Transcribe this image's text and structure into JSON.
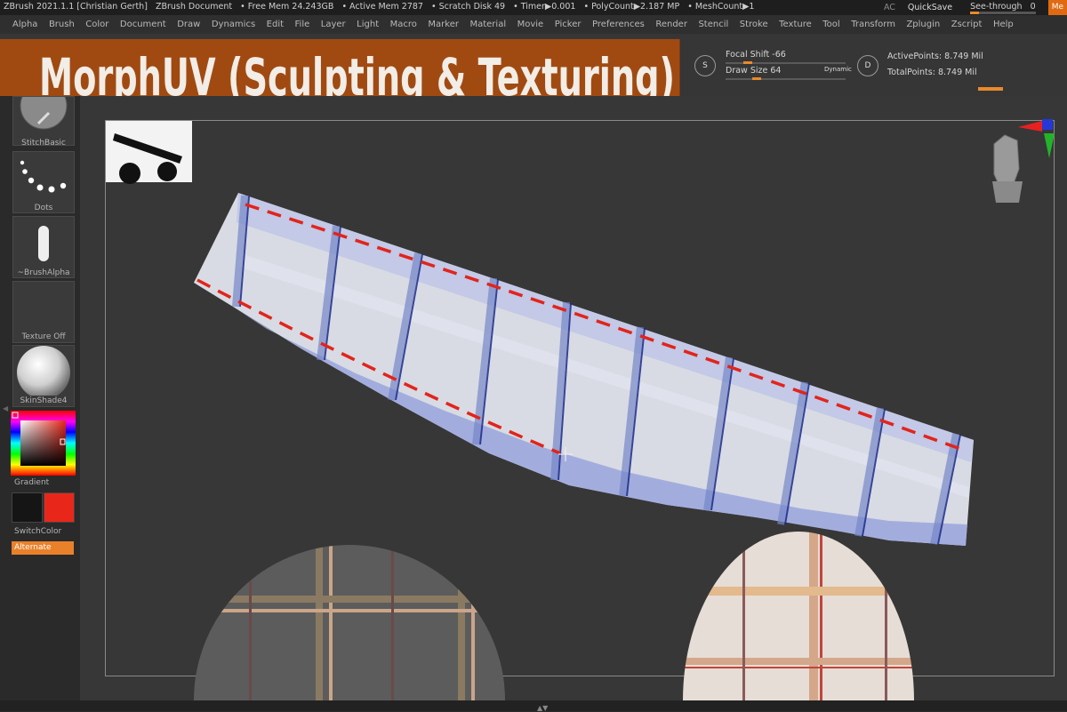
{
  "titlebar": {
    "app_title": "ZBrush 2021.1.1 [Christian Gerth]",
    "document": "ZBrush Document",
    "free_mem": "• Free Mem 24.243GB",
    "active_mem": "• Active Mem 2787",
    "scratch_disk": "• Scratch Disk 49",
    "timer": "• Timer▶0.001",
    "polycount": "• PolyCount▶2.187 MP",
    "meshcount": "• MeshCount▶1",
    "ac": "AC",
    "quicksave": "QuickSave",
    "see_through_label": "See-through",
    "see_through_value": "0",
    "menus_button": "Me"
  },
  "menus": [
    "Alpha",
    "Brush",
    "Color",
    "Document",
    "Draw",
    "Dynamics",
    "Edit",
    "File",
    "Layer",
    "Light",
    "Macro",
    "Marker",
    "Material",
    "Movie",
    "Picker",
    "Preferences",
    "Render",
    "Stencil",
    "Stroke",
    "Texture",
    "Tool",
    "Transform",
    "Zplugin",
    "Zscript",
    "Help"
  ],
  "banner": {
    "text": "MorphUV (Sculpting & Texturing)",
    "color": "#a04a12"
  },
  "top_controls": {
    "focal_shift_label": "Focal Shift",
    "focal_shift_value": "-66",
    "draw_size_label": "Draw Size",
    "draw_size_value": "64",
    "dynamic": "Dynamic",
    "s_icon": "S",
    "d_icon": "D",
    "active_points": "ActivePoints: 8.749 Mil",
    "total_points": "TotalPoints: 8.749 Mil"
  },
  "left_shelf": {
    "brush": "StitchBasic",
    "stroke": "Dots",
    "alpha": "~BrushAlpha",
    "texture": "Texture Off",
    "material": "SkinShade4",
    "gradient": "Gradient",
    "switch_color": "SwitchColor",
    "alternate": "Alternate"
  },
  "colors": {
    "main_color": "#e8271a",
    "secondary_color": "#151515",
    "accent": "#e98a2a"
  },
  "icons": {
    "view_gyro": "head-icon",
    "axis": "xyz-axis-icon"
  }
}
